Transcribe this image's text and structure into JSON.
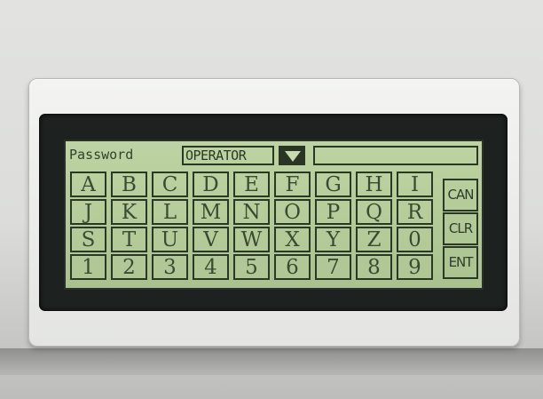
{
  "screen": {
    "password_label": "Password",
    "user_value": "OPERATOR",
    "password_value": ""
  },
  "icons": {
    "dropdown": "triangle-down-icon"
  },
  "keypad": {
    "rows": [
      [
        "A",
        "B",
        "C",
        "D",
        "E",
        "F",
        "G",
        "H",
        "I"
      ],
      [
        "J",
        "K",
        "L",
        "M",
        "N",
        "O",
        "P",
        "Q",
        "R"
      ],
      [
        "S",
        "T",
        "U",
        "V",
        "W",
        "X",
        "Y",
        "Z",
        "0"
      ],
      [
        "1",
        "2",
        "3",
        "4",
        "5",
        "6",
        "7",
        "8",
        "9"
      ]
    ],
    "function_keys": [
      "CAN",
      "CLR",
      "ENT"
    ]
  },
  "colors": {
    "lcd_background": "#b3cb98",
    "lcd_ink": "#2b3826",
    "bezel": "#ebebe9",
    "frame": "#1d2120"
  }
}
